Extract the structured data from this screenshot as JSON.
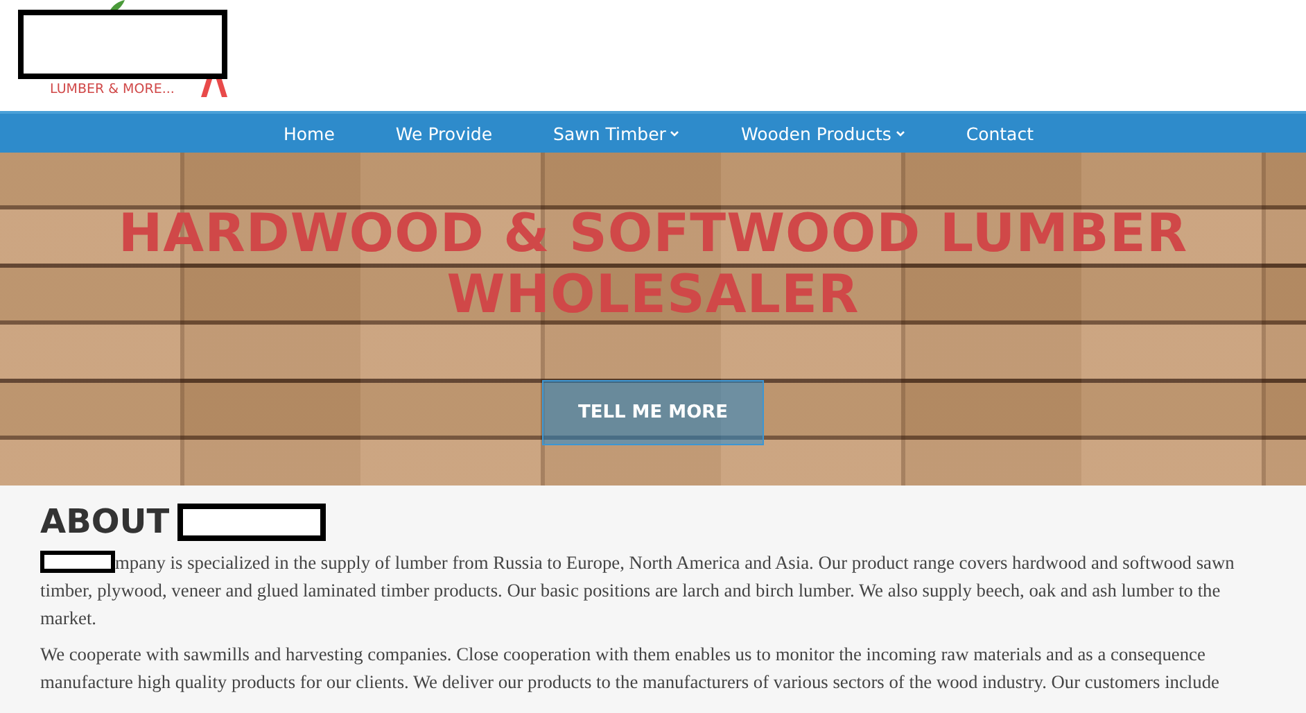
{
  "logo": {
    "tagline": "LUMBER & MORE..."
  },
  "nav": [
    {
      "label": "Home",
      "dropdown": false
    },
    {
      "label": "We Provide",
      "dropdown": false
    },
    {
      "label": "Sawn Timber",
      "dropdown": true
    },
    {
      "label": "Wooden Products",
      "dropdown": true
    },
    {
      "label": "Contact",
      "dropdown": false
    }
  ],
  "hero": {
    "title": "HARDWOOD & SOFTWOOD LUMBER WHOLESALER",
    "button": "TELL ME MORE"
  },
  "about": {
    "heading": "ABOUT",
    "paragraphs": [
      {
        "redacted_start": true,
        "text": "mpany is specialized in the supply of lumber from Russia to Europe, North America and Asia. Our product range covers hardwood and softwood sawn timber, plywood, veneer and glued laminated timber products. Our basic positions are larch and birch lumber. We also supply beech, oak and ash lumber to the market."
      },
      {
        "redacted_start": false,
        "text": "We cooperate with sawmills and harvesting companies. Close cooperation with them enables us to monitor the incoming raw materials and as a consequence manufacture high quality products for our clients. We deliver our products to the manufacturers of various sectors of the wood industry. Our customers include"
      }
    ]
  }
}
